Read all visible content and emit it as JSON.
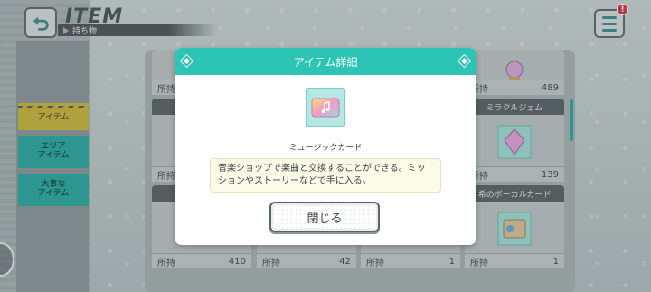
{
  "header": {
    "title": "ITEM",
    "subtitle": "持ち物",
    "menu_badge": "!"
  },
  "side_tabs": [
    {
      "label": "アイテム"
    },
    {
      "label": "エリア\nアイテム"
    },
    {
      "label": "大事な\nアイテム"
    }
  ],
  "grid": {
    "owned_label": "所持",
    "cells": [
      {
        "name": "",
        "count": ""
      },
      {
        "name": "",
        "count": "489"
      },
      {
        "name": "ミラクルジェム",
        "count": "139"
      },
      {
        "name": "希のボーカルカード",
        "count": "1"
      },
      {
        "name": "",
        "count": "410"
      },
      {
        "name": "",
        "count": "42"
      },
      {
        "name": "",
        "count": "1"
      },
      {
        "name": "",
        "count": "1"
      }
    ]
  },
  "modal": {
    "title": "アイテム詳細",
    "item_name": "ミュージックカード",
    "description": "音楽ショップで楽曲と交換することができる。ミッションやストーリーなどで手に入る。",
    "close_label": "閉じる"
  },
  "colors": {
    "accent": "#2cc4b5",
    "tab_active": "#c9b63c",
    "tab_inactive": "#2aa89f",
    "badge": "#d3344b"
  }
}
